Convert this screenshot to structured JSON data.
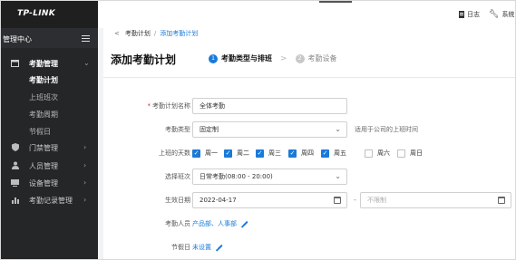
{
  "brand": {
    "logo_text": "TP-LINK"
  },
  "sidebar": {
    "management_title": "管理中心",
    "sections": [
      {
        "label": "考勤管理",
        "icon": "calendar-icon",
        "expanded": true,
        "children": [
          {
            "label": "考勤计划",
            "active": true
          },
          {
            "label": "上班班次",
            "active": false
          },
          {
            "label": "考勤周期",
            "active": false
          },
          {
            "label": "节假日",
            "active": false
          }
        ]
      },
      {
        "label": "门禁管理",
        "icon": "shield-icon",
        "expanded": false
      },
      {
        "label": "人员管理",
        "icon": "person-icon",
        "expanded": false
      },
      {
        "label": "设备管理",
        "icon": "device-icon",
        "expanded": false
      },
      {
        "label": "考勤记录管理",
        "icon": "chart-bars-icon",
        "expanded": false
      }
    ]
  },
  "topbar": {
    "log_label": "日志",
    "system_label": "系统"
  },
  "breadcrumb": {
    "back": "<",
    "parent": "考勤计划",
    "separator": "/",
    "current": "添加考勤计划"
  },
  "page": {
    "title": "添加考勤计划"
  },
  "steps": [
    {
      "number": "1",
      "label": "考勤类型与排班",
      "active": true
    },
    {
      "number": "2",
      "label": "考勤设备",
      "active": false
    }
  ],
  "step_arrow": ">",
  "form": {
    "plan_name": {
      "label": "考勤计划名称",
      "value": "全体考勤",
      "required": true
    },
    "attendance_type": {
      "label": "考勤类型",
      "value": "固定制",
      "hint": "适用于公司的上班时间"
    },
    "workdays": {
      "label": "上班的天数",
      "days": [
        {
          "label": "周一",
          "checked": true
        },
        {
          "label": "周二",
          "checked": true
        },
        {
          "label": "周三",
          "checked": true
        },
        {
          "label": "周四",
          "checked": true
        },
        {
          "label": "周五",
          "checked": true
        },
        {
          "label": "周六",
          "checked": false
        },
        {
          "label": "周日",
          "checked": false
        }
      ]
    },
    "shift": {
      "label": "选择班次",
      "value": "日常考勤(08:00 - 20:00)"
    },
    "effective_date": {
      "label": "生效日期",
      "start": "2022-04-17",
      "separator": "-",
      "end_placeholder": "不限制"
    },
    "members": {
      "label": "考勤人员",
      "value": "产品部、人事部"
    },
    "holidays": {
      "label": "节假日",
      "value": "未设置"
    }
  },
  "colors": {
    "accent": "#1a7ad9",
    "sidebar_bg": "#252628"
  }
}
